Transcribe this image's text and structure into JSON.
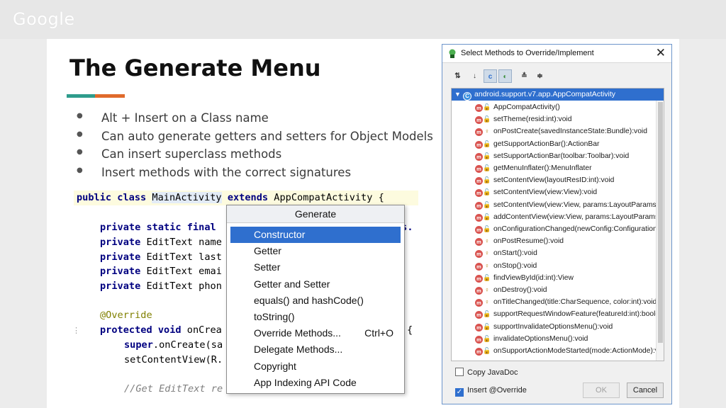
{
  "header": {
    "logo": "Google"
  },
  "slide": {
    "title": "The Generate Menu",
    "bullets": [
      "Alt + Insert on a Class name",
      "Can auto generate getters and setters for Object Models",
      "Can insert superclass methods",
      "Insert methods with the correct signatures"
    ]
  },
  "code": {
    "line1": {
      "kw": "public class",
      "cls": "MainActivity",
      "kw2": "extends",
      "rest": "AppCompatActivity {"
    },
    "line2": {
      "kw": "private static final",
      "rest": "ss."
    },
    "line3": {
      "kw": "private",
      "rest": "EditText name"
    },
    "line4": {
      "kw": "private",
      "rest": "EditText last"
    },
    "line5": {
      "kw": "private",
      "rest": "EditText emai"
    },
    "line6": {
      "kw": "private",
      "rest": "EditText phon"
    },
    "line7": "@Override",
    "line8": {
      "kw": "protected void",
      "rest": "onCrea",
      "tail": "{"
    },
    "line9": {
      "kw": "super",
      "rest": ".onCreate(sa"
    },
    "line10": "setContentView(R.",
    "line11": "//Get EditText re",
    "gutter": "⋮"
  },
  "generate_menu": {
    "title": "Generate",
    "items": [
      {
        "label": "Constructor",
        "shortcut": ""
      },
      {
        "label": "Getter",
        "shortcut": ""
      },
      {
        "label": "Setter",
        "shortcut": ""
      },
      {
        "label": "Getter and Setter",
        "shortcut": ""
      },
      {
        "label": "equals() and hashCode()",
        "shortcut": ""
      },
      {
        "label": "toString()",
        "shortcut": ""
      },
      {
        "label": "Override Methods...",
        "shortcut": "Ctrl+O"
      },
      {
        "label": "Delegate Methods...",
        "shortcut": ""
      },
      {
        "label": "Copyright",
        "shortcut": ""
      },
      {
        "label": "App Indexing API Code",
        "shortcut": ""
      }
    ]
  },
  "dialog": {
    "title": "Select Methods to Override/Implement",
    "close_glyph": "✕",
    "toolbar": [
      "⇅",
      "↓",
      "c",
      "◐",
      "≛",
      "≑"
    ],
    "root": "android.support.v7.app.AppCompatActivity",
    "methods": [
      {
        "name": "AppCompatActivity()",
        "access": "public"
      },
      {
        "name": "setTheme(resid:int):void",
        "access": "public"
      },
      {
        "name": "onPostCreate(savedInstanceState:Bundle):void",
        "access": "protected"
      },
      {
        "name": "getSupportActionBar():ActionBar",
        "access": "public"
      },
      {
        "name": "setSupportActionBar(toolbar:Toolbar):void",
        "access": "public"
      },
      {
        "name": "getMenuInflater():MenuInflater",
        "access": "public"
      },
      {
        "name": "setContentView(layoutResID:int):void",
        "access": "public"
      },
      {
        "name": "setContentView(view:View):void",
        "access": "public"
      },
      {
        "name": "setContentView(view:View, params:LayoutParams):v",
        "access": "public"
      },
      {
        "name": "addContentView(view:View, params:LayoutParams):",
        "access": "public"
      },
      {
        "name": "onConfigurationChanged(newConfig:Configuration",
        "access": "public"
      },
      {
        "name": "onPostResume():void",
        "access": "protected"
      },
      {
        "name": "onStart():void",
        "access": "protected"
      },
      {
        "name": "onStop():void",
        "access": "protected"
      },
      {
        "name": "findViewById(id:int):View",
        "access": "public"
      },
      {
        "name": "onDestroy():void",
        "access": "protected"
      },
      {
        "name": "onTitleChanged(title:CharSequence, color:int):void",
        "access": "protected"
      },
      {
        "name": "supportRequestWindowFeature(featureId:int):boole",
        "access": "public"
      },
      {
        "name": "supportInvalidateOptionsMenu():void",
        "access": "public"
      },
      {
        "name": "invalidateOptionsMenu():void",
        "access": "public"
      },
      {
        "name": "onSupportActionModeStarted(mode:ActionMode):v",
        "access": "public"
      }
    ],
    "copy_javadoc": {
      "label": "Copy JavaDoc",
      "checked": false
    },
    "insert_override": {
      "label": "Insert @Override",
      "checked": true
    },
    "ok_label": "OK",
    "cancel_label": "Cancel"
  }
}
